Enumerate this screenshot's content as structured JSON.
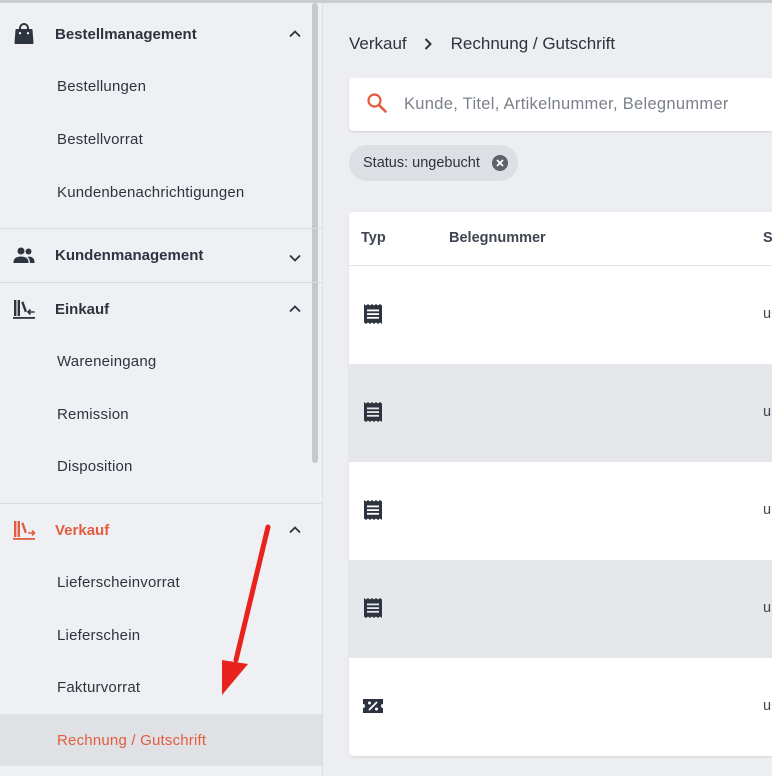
{
  "colors": {
    "accent": "#e35d3f",
    "text": "#2d3440",
    "arrow": "#e8221c"
  },
  "sidebar": {
    "sections": [
      {
        "label": "Bestellmanagement",
        "icon": "shopping-bag-icon",
        "expanded": true,
        "items": [
          "Bestellungen",
          "Bestellvorrat",
          "Kundenbenachrichtigungen"
        ]
      },
      {
        "label": "Kundenmanagement",
        "icon": "people-icon",
        "expanded": false,
        "items": []
      },
      {
        "label": "Einkauf",
        "icon": "books-incoming-icon",
        "expanded": true,
        "items": [
          "Wareneingang",
          "Remission",
          "Disposition"
        ]
      },
      {
        "label": "Verkauf",
        "icon": "books-outgoing-icon",
        "expanded": true,
        "active": true,
        "items": [
          "Lieferscheinvorrat",
          "Lieferschein",
          "Fakturvorrat",
          "Rechnung / Gutschrift"
        ],
        "selected_item": "Rechnung / Gutschrift"
      }
    ]
  },
  "breadcrumb": {
    "items": [
      "Verkauf",
      "Rechnung / Gutschrift"
    ]
  },
  "search": {
    "placeholder": "Kunde, Titel, Artikelnummer, Belegnummer",
    "value": ""
  },
  "filter_chip": {
    "label": "Status: ungebucht"
  },
  "table": {
    "columns": [
      "Typ",
      "Belegnummer",
      "St"
    ],
    "rows": [
      {
        "type_icon": "receipt-icon",
        "belegnummer": "",
        "status": "u"
      },
      {
        "type_icon": "receipt-icon",
        "belegnummer": "",
        "status": "u"
      },
      {
        "type_icon": "receipt-icon",
        "belegnummer": "",
        "status": "u"
      },
      {
        "type_icon": "receipt-icon",
        "belegnummer": "",
        "status": "u"
      },
      {
        "type_icon": "discount-ticket-icon",
        "belegnummer": "",
        "status": "u"
      }
    ]
  }
}
